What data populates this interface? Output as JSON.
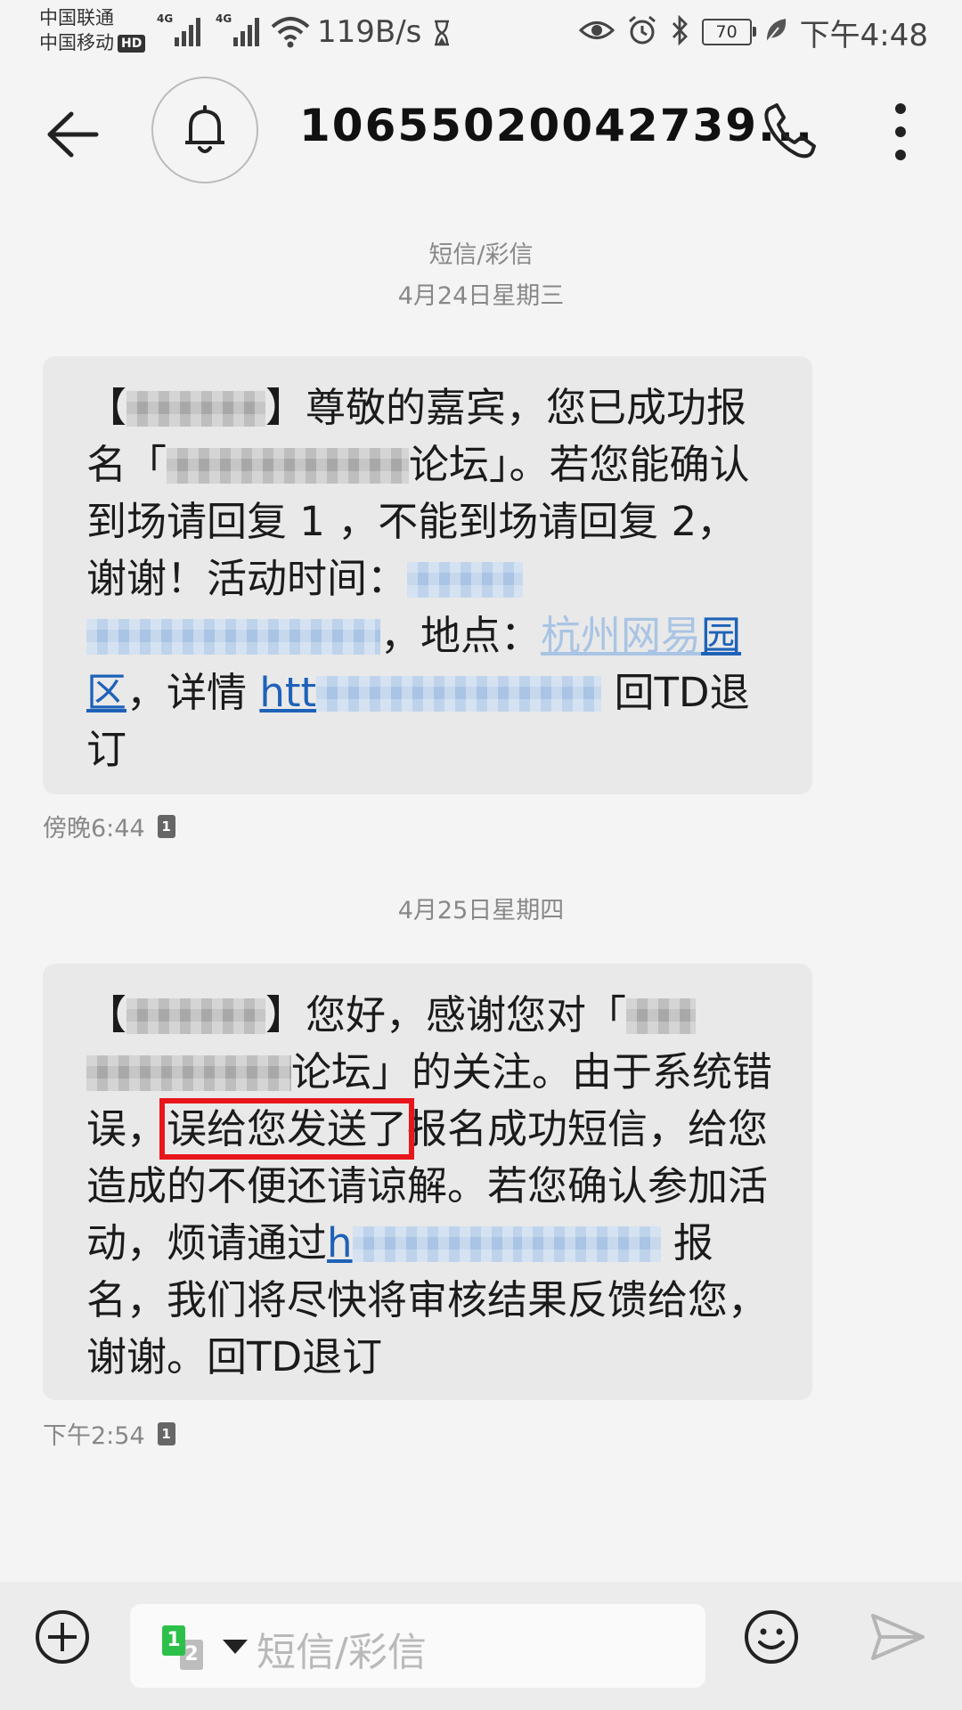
{
  "status_bar": {
    "carrier_1": "中国联通",
    "carrier_2": "中国移动",
    "hd_badge": "HD",
    "network_1": "4G",
    "network_2": "4G",
    "speed": "119B/s",
    "battery": "70",
    "time": "下午4:48"
  },
  "header": {
    "title": "10655020042739..."
  },
  "conversation": {
    "type_label": "短信/彩信",
    "messages": [
      {
        "date": "4月24日星期三",
        "time": "傍晚6:44",
        "sim": "1",
        "parts": {
          "p1": "【",
          "p2": "】尊敬的嘉宾，您已成功报名「",
          "p3": "论坛」。若您能确认到场请回复 1 ，不能到场请回复 2，谢谢！活动时间：",
          "p4": "，地点：",
          "link_loc_a": "杭州网易",
          "link_loc_b": "园区",
          "p5": "，详情 ",
          "link_url_start": "htt",
          "p6": " 回TD退订"
        }
      },
      {
        "date": "4月25日星期四",
        "time": "下午2:54",
        "sim": "1",
        "parts": {
          "p1": "【",
          "p2": "】您好，感谢您对「",
          "p3": "论坛」的关注。由于系统错误，",
          "highlight": "误给您发送了",
          "p4": "报名成功短信，给您造成的不便还请谅解。若您确认参加活动，烦请通过",
          "link_url_start": "h",
          "p5": " 报名，我们将尽快将审核结果反馈给您，谢谢。回TD退订"
        }
      }
    ]
  },
  "composer": {
    "placeholder": "短信/彩信",
    "sim_primary": "1",
    "sim_secondary": "2"
  }
}
